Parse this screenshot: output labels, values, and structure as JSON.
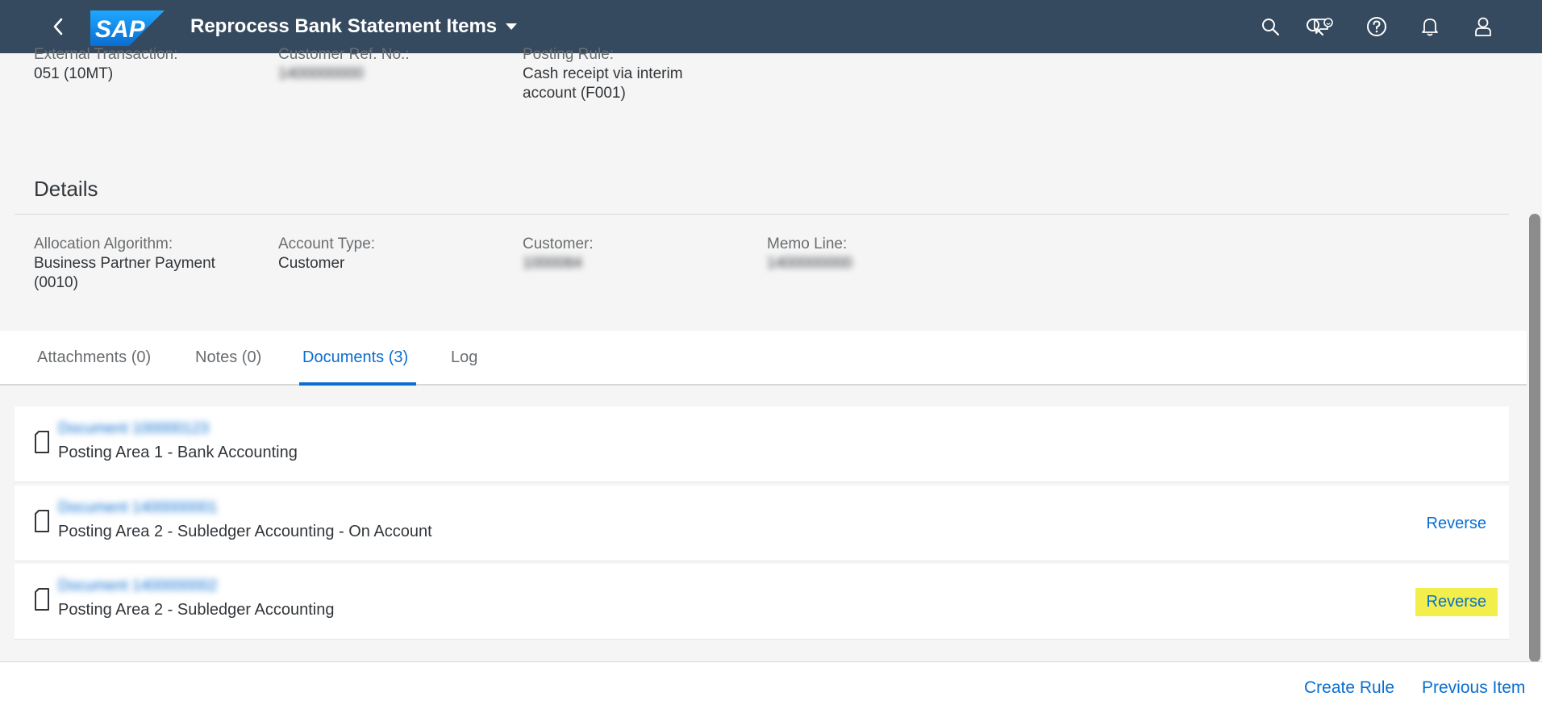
{
  "shell": {
    "title": "Reprocess Bank Statement Items",
    "logo_text": "SAP",
    "icons": [
      "back-icon",
      "search-icon",
      "feedback-icon",
      "help-icon",
      "notifications-icon",
      "user-icon"
    ]
  },
  "top_fields": [
    {
      "label": "External Transaction:",
      "value": "051 (10MT)"
    },
    {
      "label": "Customer Ref. No.:",
      "value": "1400000000"
    },
    {
      "label": "Posting Rule:",
      "value_lines": [
        "Cash receipt via interim",
        "account (F001)"
      ]
    }
  ],
  "details": {
    "title": "Details",
    "fields": [
      {
        "label": "Allocation Algorithm:",
        "value_lines": [
          "Business Partner Payment",
          "(0010)"
        ]
      },
      {
        "label": "Account Type:",
        "value": "Customer"
      },
      {
        "label": "Customer:",
        "value": "1000084"
      },
      {
        "label": "Memo Line:",
        "value": "1400000000"
      }
    ]
  },
  "tabs": [
    {
      "label": "Attachments (0)",
      "active": false
    },
    {
      "label": "Notes (0)",
      "active": false
    },
    {
      "label": "Documents (3)",
      "active": true
    },
    {
      "label": "Log",
      "active": false
    }
  ],
  "documents": [
    {
      "link": "Document 100000123",
      "description": "Posting Area 1 - Bank Accounting",
      "action": ""
    },
    {
      "link": "Document 1400000001",
      "description": "Posting Area 2 - Subledger Accounting - On Account",
      "action": "Reverse"
    },
    {
      "link": "Document 1400000002",
      "description": "Posting Area 2 - Subledger Accounting",
      "action": "Reverse",
      "highlighted": true
    }
  ],
  "footer": {
    "create_rule": "Create Rule",
    "previous_item": "Previous Item"
  },
  "colors": {
    "shell_bg": "#354a5f",
    "link": "#0a6ed1",
    "highlight": "#f2ef4c",
    "page_bg": "#f5f5f5"
  }
}
